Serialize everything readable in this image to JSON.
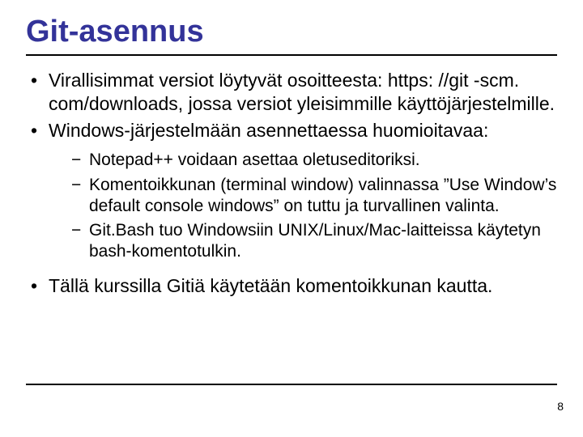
{
  "title": "Git-asennus",
  "bullets": {
    "b1": "Virallisimmat versiot löytyvät osoitteesta: https: //git -scm. com/downloads, jossa versiot yleisimmille käyttöjärjestelmille.",
    "b2": "Windows-järjestelmään asennettaessa huomioitavaa:",
    "sub1": "Notepad++ voidaan asettaa oletuseditoriksi.",
    "sub2": "Komentoikkunan (terminal window) valinnassa ”Use Window’s default console windows” on tuttu ja turvallinen valinta.",
    "sub3": "Git.Bash tuo Windowsiin UNIX/Linux/Mac-laitteissa käytetyn bash-komentotulkin.",
    "b3": "Tällä kurssilla Gitiä käytetään komentoikkunan kautta."
  },
  "page_number": "8"
}
